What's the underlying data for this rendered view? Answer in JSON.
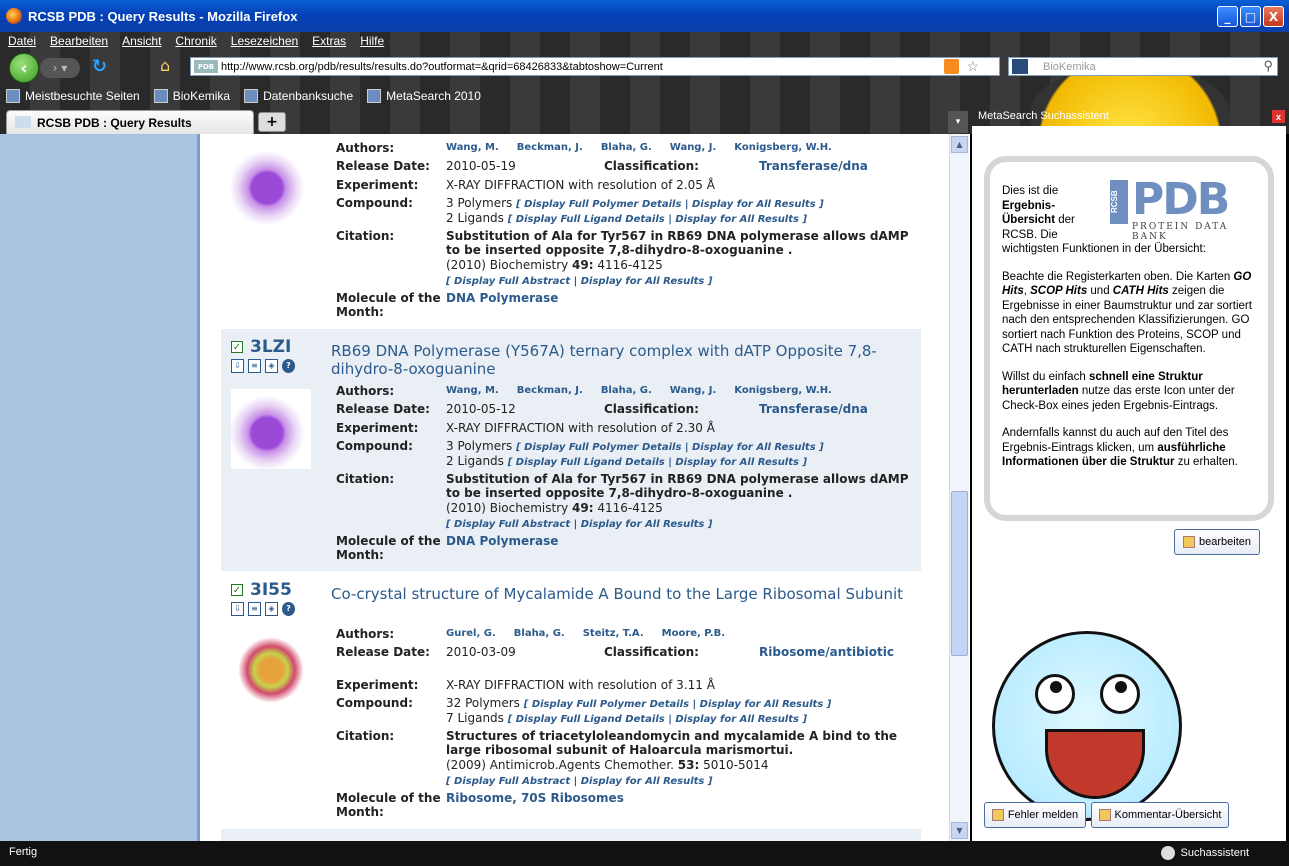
{
  "window": {
    "title": "RCSB PDB : Query Results - Mozilla Firefox",
    "min": "_",
    "max": "□",
    "close": "X"
  },
  "menu": [
    "Datei",
    "Bearbeiten",
    "Ansicht",
    "Chronik",
    "Lesezeichen",
    "Extras",
    "Hilfe"
  ],
  "nav": {
    "url": "http://www.rcsb.org/pdb/results/results.do?outformat=&qrid=68426833&tabtoshow=Current",
    "search_placeholder": "BioKemika",
    "favicon_text": "PDB"
  },
  "bookmarks": [
    "Meistbesuchte Seiten",
    "BioKemika",
    "Datenbanksuche",
    "MetaSearch 2010"
  ],
  "tab": {
    "label": "RCSB PDB : Query Results",
    "new": "+"
  },
  "labels": {
    "authors": "Authors:",
    "release": "Release Date:",
    "classification": "Classification:",
    "experiment": "Experiment:",
    "compound": "Compound:",
    "citation": "Citation:",
    "molecule1": "Molecule of the",
    "molecule2": "Month:",
    "disp_polymer": "[ Display Full Polymer Details  |  Display for All Results ]",
    "disp_ligand": "[ Display Full Ligand Details  |  Display for All Results ]",
    "disp_abstract": "[ Display Full Abstract  |  Display for All Results ]"
  },
  "results": [
    {
      "authors": [
        "Wang, M.",
        "Beckman, J.",
        "Blaha, G.",
        "Wang, J.",
        "Konigsberg, W.H."
      ],
      "release": "2010-05-19",
      "classification": "Transferase/dna",
      "experiment": "X-RAY DIFFRACTION with resolution of 2.05 Å",
      "polymers": "3 Polymers",
      "ligands": "2 Ligands",
      "citation_title": "Substitution of Ala for Tyr567 in RB69 DNA polymerase allows dAMP to be inserted opposite 7,8-dihydro-8-oxoguanine .",
      "citation_ref": "(2010) Biochemistry ",
      "citation_vol": "49:",
      "citation_pages": " 4116-4125",
      "molecule": "DNA Polymerase"
    },
    {
      "id": "3LZI",
      "title": "RB69 DNA Polymerase (Y567A) ternary complex with dATP Opposite 7,8-dihydro-8-oxoguanine",
      "authors": [
        "Wang, M.",
        "Beckman, J.",
        "Blaha, G.",
        "Wang, J.",
        "Konigsberg, W.H."
      ],
      "release": "2010-05-12",
      "classification": "Transferase/dna",
      "experiment": "X-RAY DIFFRACTION with resolution of 2.30 Å",
      "polymers": "3 Polymers",
      "ligands": "2 Ligands",
      "citation_title": "Substitution of Ala for Tyr567 in RB69 DNA polymerase allows dAMP to be inserted opposite 7,8-dihydro-8-oxoguanine .",
      "citation_ref": "(2010) Biochemistry ",
      "citation_vol": "49:",
      "citation_pages": " 4116-4125",
      "molecule": "DNA Polymerase"
    },
    {
      "id": "3I55",
      "title": "Co-crystal structure of Mycalamide A Bound to the Large Ribosomal Subunit",
      "authors": [
        "Gurel, G.",
        "Blaha, G.",
        "Steitz, T.A.",
        "Moore, P.B."
      ],
      "release": "2010-03-09",
      "classification": "Ribosome/antibiotic",
      "experiment": "X-RAY DIFFRACTION with resolution of 3.11 Å",
      "polymers": "32 Polymers",
      "ligands": "7 Ligands",
      "citation_title": "Structures of triacetyloleandomycin and mycalamide A bind to the large ribosomal subunit of Haloarcula marismortui.",
      "citation_ref": "(2009) Antimicrob.Agents Chemother. ",
      "citation_vol": "53:",
      "citation_pages": " 5010-5014",
      "molecule": "Ribosome, 70S Ribosomes"
    }
  ],
  "sidebar": {
    "header": "MetaSearch Suchassistent",
    "close": "x",
    "logo_big": "PDB",
    "logo_side": "RCSB",
    "logo_sub": "PROTEIN DATA BANK",
    "p1a": "Dies ist die ",
    "p1b": "Ergebnis-Übersicht",
    "p1c": " der RCSB. Die wichtigsten Funktionen in der Übersicht:",
    "p2a": "Beachte die Registerkarten oben. Die Karten ",
    "p2b": "GO Hits",
    "p2c": ", ",
    "p2d": "SCOP Hits",
    "p2e": " und ",
    "p2f": "CATH Hits",
    "p2g": " zeigen die Ergebnisse in einer Baumstruktur und zar sortiert nach den entsprechenden Klassifizierungen. GO sortiert nach Funktion des Proteins, SCOP und CATH nach strukturellen Eigenschaften.",
    "p3a": "Willst du einfach ",
    "p3b": "schnell eine Struktur herunterladen",
    "p3c": " nutze das erste Icon unter der Check-Box eines jeden Ergebnis-Eintrags.",
    "p4a": "Andernfalls kannst du auch auf den Titel des Ergebnis-Eintrags klicken, um ",
    "p4b": "ausführliche Informationen über die Struktur",
    "p4c": " zu erhalten.",
    "edit": "bearbeiten",
    "report": "Fehler melden",
    "comments": "Kommentar-Übersicht"
  },
  "status": {
    "left": "Fertig",
    "right": "Suchassistent"
  }
}
